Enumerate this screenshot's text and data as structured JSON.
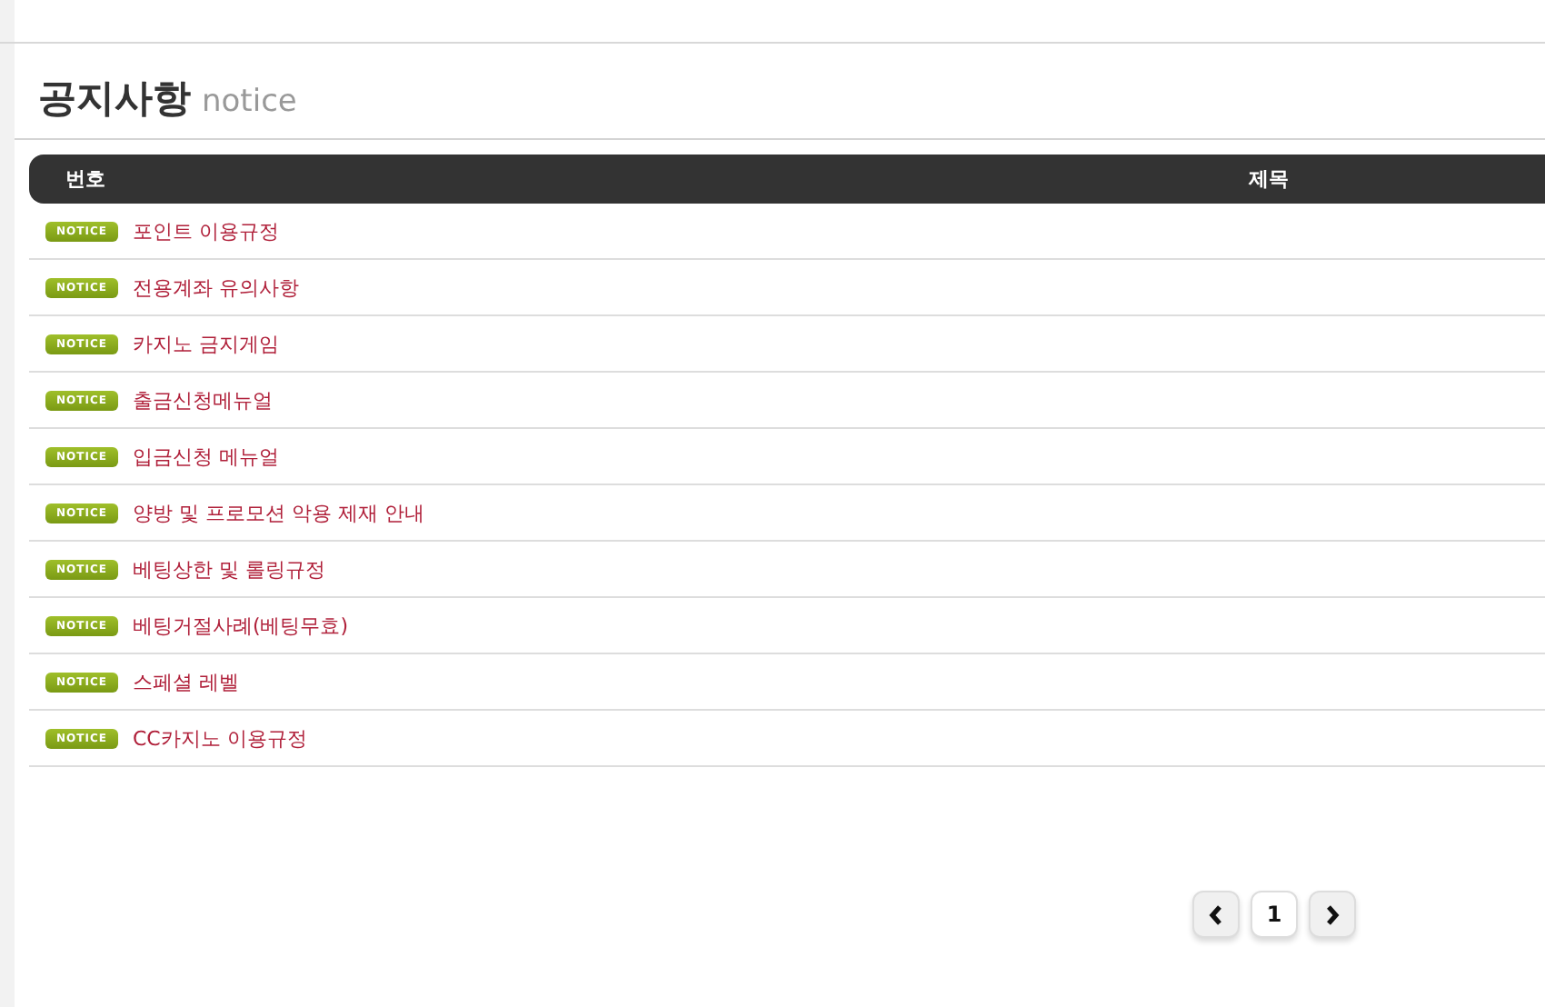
{
  "heading": {
    "title": "공지사항",
    "subtitle": "notice"
  },
  "table": {
    "columns": [
      "번호",
      "제목"
    ],
    "rows": [
      {
        "badge": "NOTICE",
        "title": "포인트 이용규정"
      },
      {
        "badge": "NOTICE",
        "title": "전용계좌 유의사항"
      },
      {
        "badge": "NOTICE",
        "title": "카지노 금지게임"
      },
      {
        "badge": "NOTICE",
        "title": "출금신청메뉴얼"
      },
      {
        "badge": "NOTICE",
        "title": "입금신청 메뉴얼"
      },
      {
        "badge": "NOTICE",
        "title": "양방 및 프로모션 악용 제재 안내"
      },
      {
        "badge": "NOTICE",
        "title": "베팅상한 및 롤링규정"
      },
      {
        "badge": "NOTICE",
        "title": "베팅거절사례(베팅무효)"
      },
      {
        "badge": "NOTICE",
        "title": "스페셜 레벨"
      },
      {
        "badge": "NOTICE",
        "title": "CC카지노 이용규정"
      }
    ]
  },
  "pagination": {
    "pages": [
      {
        "label": "1",
        "selected": true
      }
    ]
  }
}
